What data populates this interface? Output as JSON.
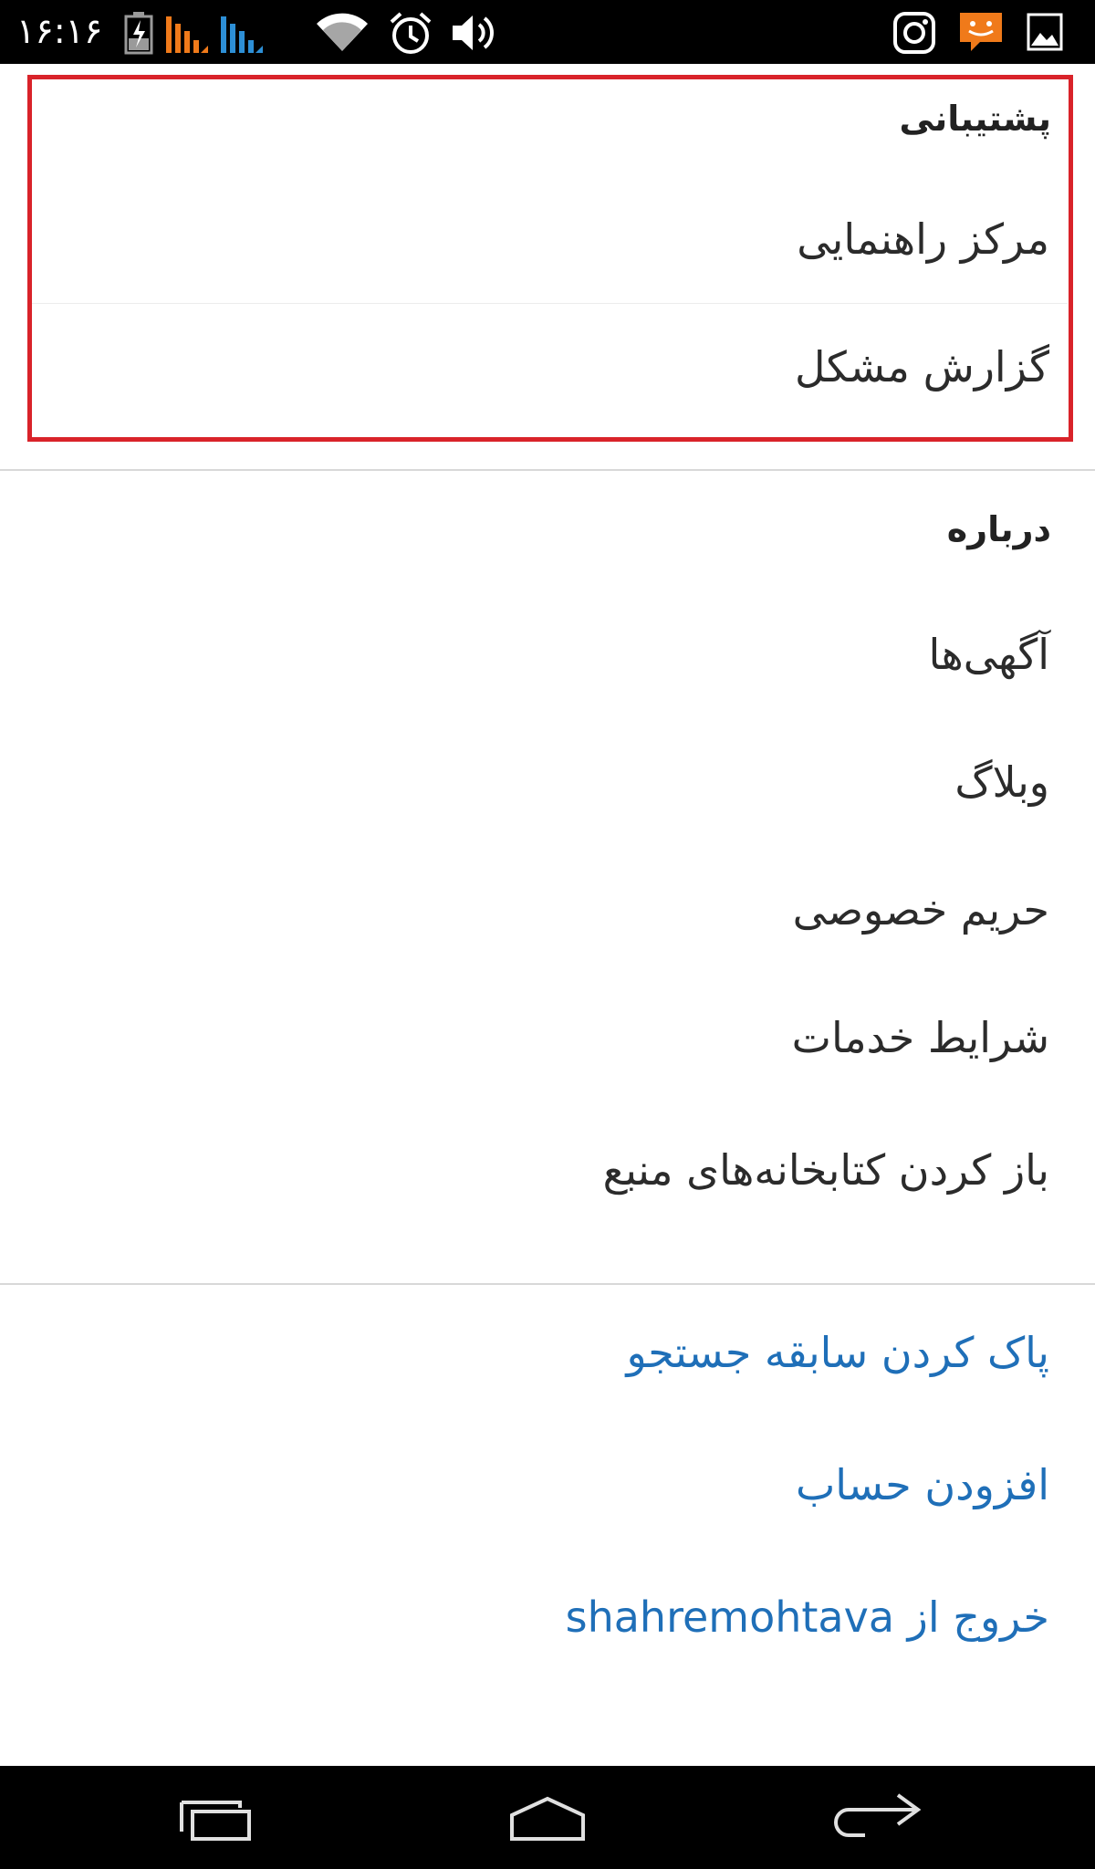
{
  "status_bar": {
    "time": "۱۶:۱۶",
    "icons": [
      "battery-charging-icon",
      "signal-orange-icon",
      "signal-blue-icon",
      "wifi-icon",
      "alarm-icon",
      "volume-icon",
      "instagram-icon",
      "chat-icon",
      "image-icon"
    ],
    "colors": {
      "signal_orange": "#f07a1a",
      "signal_blue": "#2d8fd6",
      "chat_orange": "#f07a1a"
    }
  },
  "support_section": {
    "header": "پشتیبانی",
    "items": [
      {
        "label": "مرکز راهنمایی"
      },
      {
        "label": "گزارش مشکل"
      }
    ]
  },
  "about_section": {
    "header": "درباره",
    "items": [
      {
        "label": "آگهی‌ها"
      },
      {
        "label": "وبلاگ"
      },
      {
        "label": "حریم خصوصی"
      },
      {
        "label": "شرایط خدمات"
      },
      {
        "label": "باز کردن کتابخانه‌های منبع"
      }
    ]
  },
  "account_actions": {
    "items": [
      {
        "label": "پاک کردن سابقه جستجو"
      },
      {
        "label": "افزودن حساب"
      },
      {
        "label": "خروج از shahremohtava"
      }
    ]
  },
  "nav_bar": {
    "buttons": [
      "recent-apps-icon",
      "home-icon",
      "back-icon"
    ]
  },
  "colors": {
    "link": "#1f6fb8",
    "highlight": "#d9232a",
    "text": "#2b2b2b"
  }
}
